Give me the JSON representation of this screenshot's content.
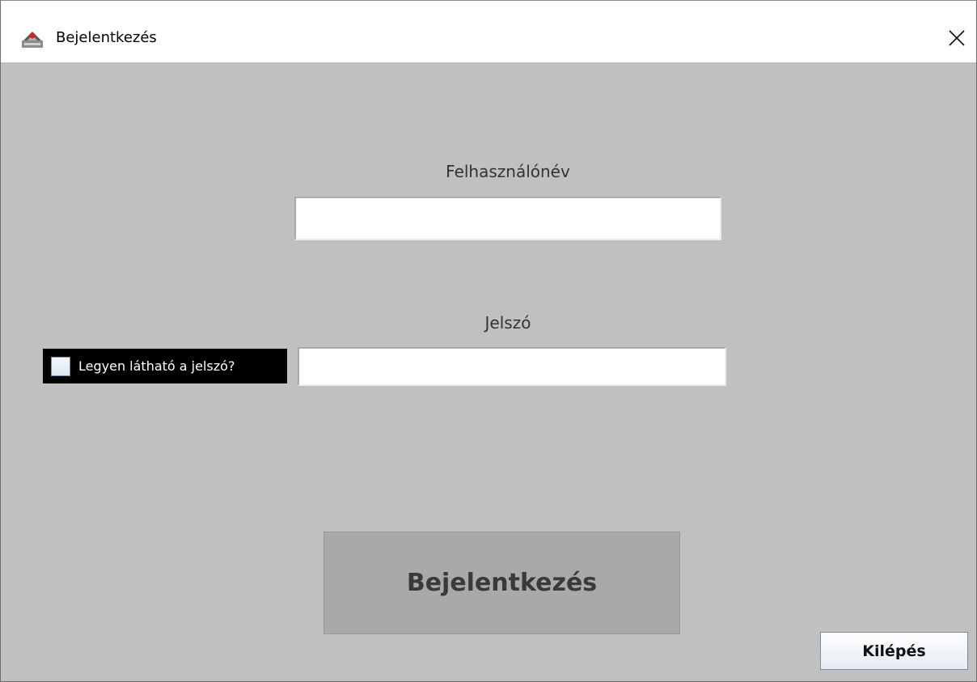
{
  "window": {
    "title": "Bejelentkezés",
    "app_icon": "java-duke-icon",
    "close_icon": "close-icon"
  },
  "form": {
    "username_label": "Felhasználónév",
    "username_value": "",
    "password_label": "Jelszó",
    "password_value": "",
    "show_password_label": "Legyen látható a jelszó?",
    "show_password_checked": false,
    "login_button": "Bejelentkezés",
    "exit_button": "Kilépés"
  },
  "colors": {
    "background": "#c0c0c0",
    "titlebar": "#ffffff",
    "login_button_bg": "#a9a9a9",
    "checkbox_panel_bg": "#000000"
  }
}
